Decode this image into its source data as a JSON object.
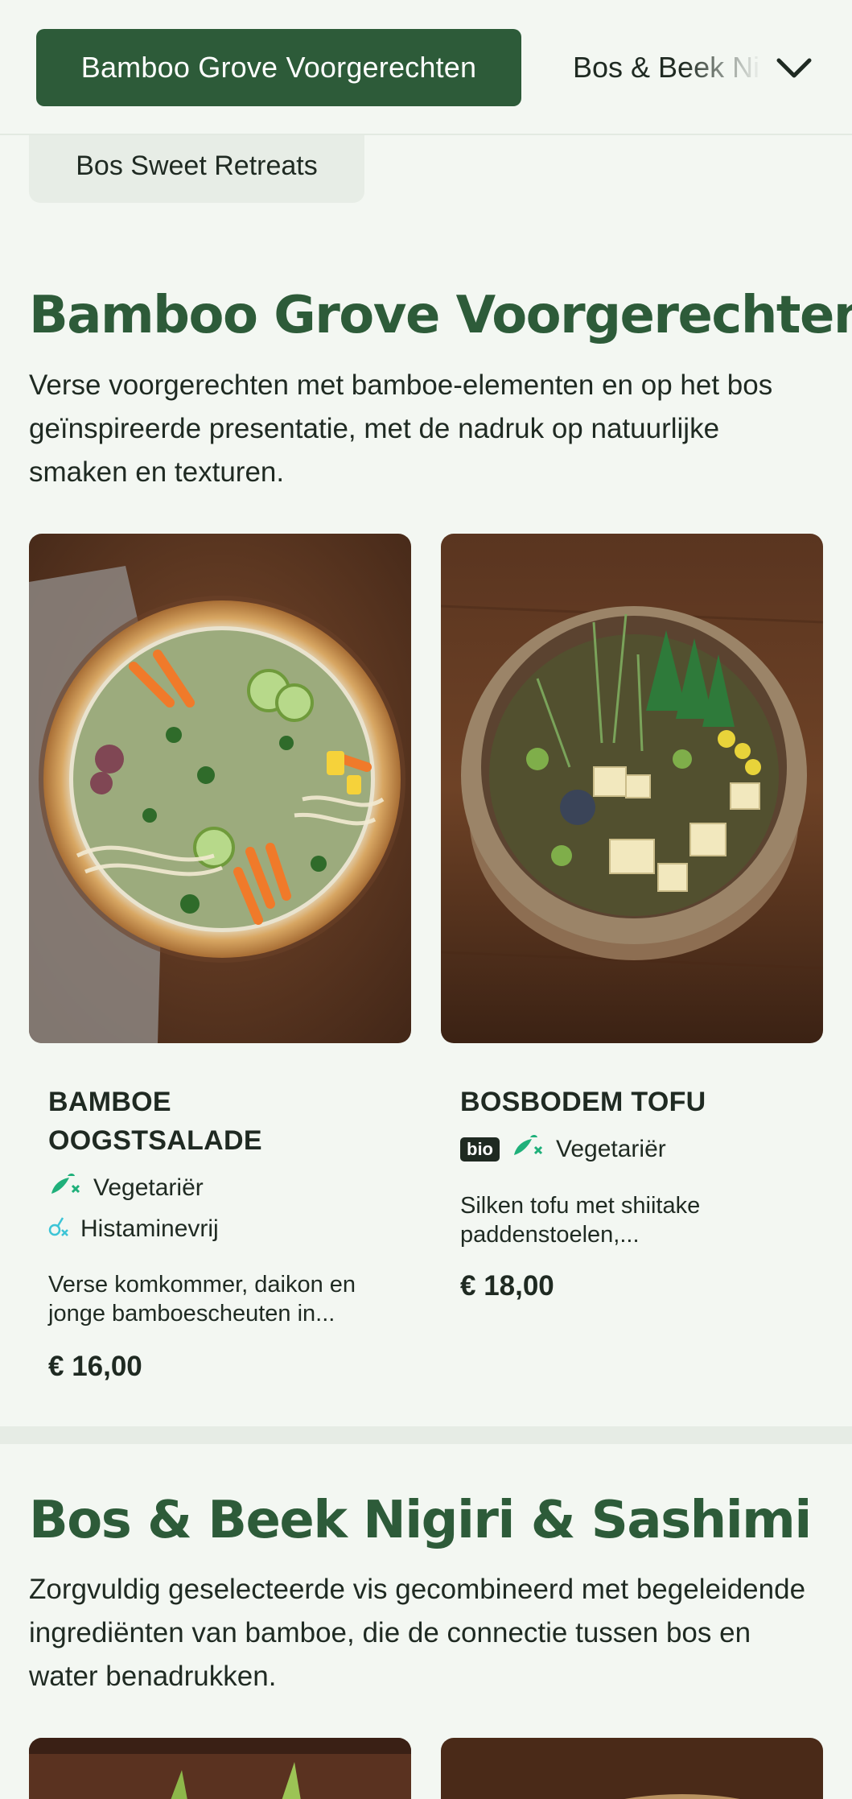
{
  "nav": {
    "active_category": "Bamboo Grove Voorgerechten",
    "next_category": "Bos & Beek Nigiri & Sashimi",
    "sub_category": "Bos Sweet Retreats"
  },
  "sections": [
    {
      "title": "Bamboo Grove Voorgerechten",
      "description": "Verse voorgerechten met bamboe-elementen en op het bos geïnspireerde presentatie, met de nadruk op natuurlijke smaken en texturen.",
      "dishes": [
        {
          "name": "BAMBOE OOGSTSALADE",
          "tags": [
            "Vegetariër",
            "Histaminevrij"
          ],
          "tag_icons": [
            "vegetarian-icon",
            "histamine-free-icon"
          ],
          "description": "Verse komkommer, daikon en jonge bamboescheuten in...",
          "price": "€ 16,00"
        },
        {
          "name": "BOSBODEM TOFU",
          "badge": "bio",
          "tags": [
            "Vegetariër"
          ],
          "tag_icons": [
            "vegetarian-icon"
          ],
          "description": "Silken tofu met shiitake paddenstoelen,...",
          "price": "€ 18,00"
        }
      ]
    },
    {
      "title": "Bos & Beek Nigiri & Sashimi",
      "description": "Zorgvuldig geselecteerde vis gecombineerd met begeleidende ingrediënten van bamboe, die de connectie tussen bos en water benadrukken."
    }
  ],
  "colors": {
    "brand_green": "#2d5b39",
    "background": "#f3f7f2",
    "tag_green": "#1fb07a",
    "tag_cyan": "#3cc4d6"
  }
}
